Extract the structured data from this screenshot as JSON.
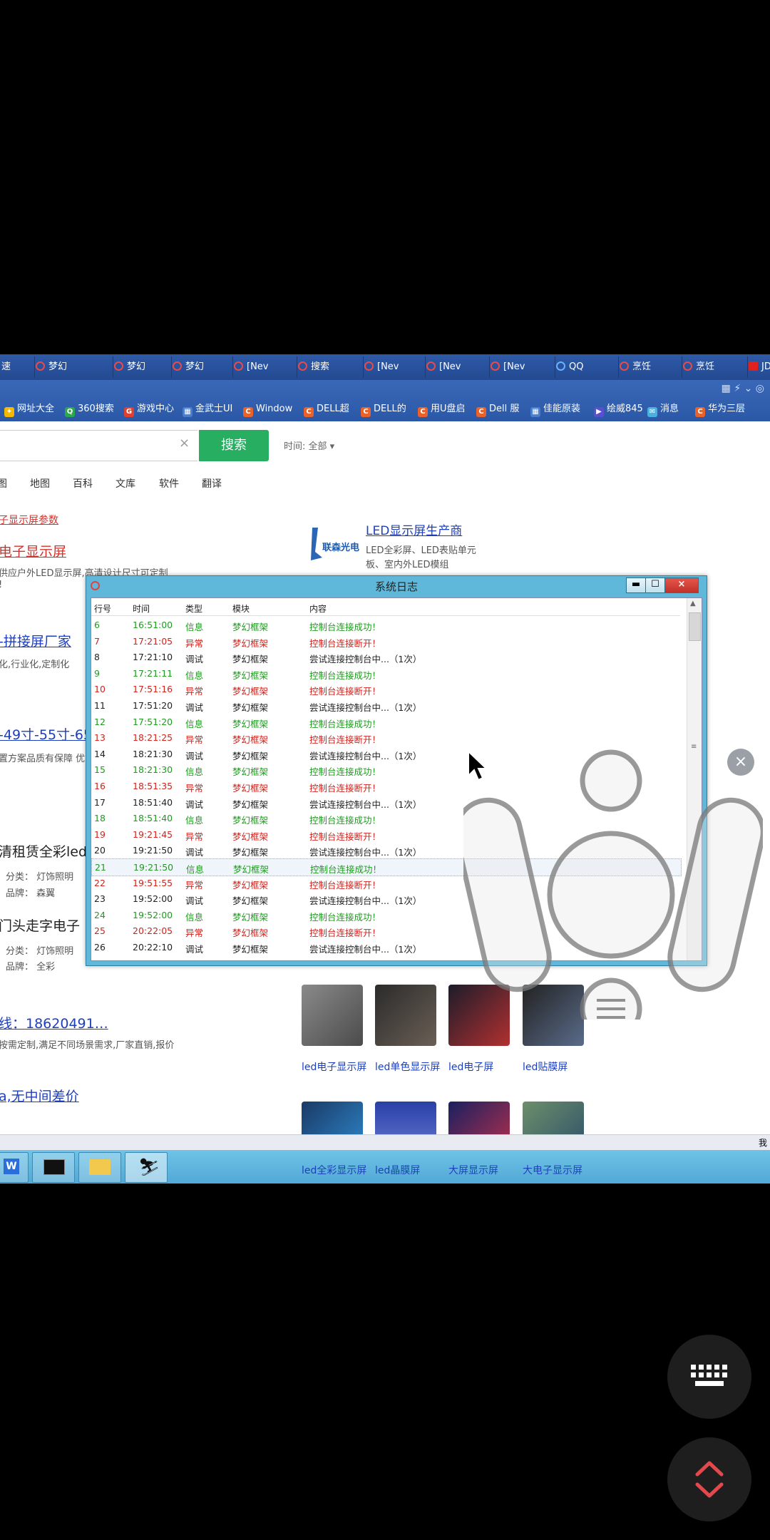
{
  "tabs": [
    {
      "label": "速",
      "type": "plain"
    },
    {
      "label": "梦幻",
      "type": "red"
    },
    {
      "label": "梦幻",
      "type": "red"
    },
    {
      "label": "梦幻",
      "type": "red"
    },
    {
      "label": "[Nev",
      "type": "red"
    },
    {
      "label": "搜索",
      "type": "red"
    },
    {
      "label": "[Nev",
      "type": "red"
    },
    {
      "label": "[Nev",
      "type": "red"
    },
    {
      "label": "[Nev",
      "type": "red"
    },
    {
      "label": "QQ",
      "type": "qq"
    },
    {
      "label": "烹饪",
      "type": "red"
    },
    {
      "label": "烹饪",
      "type": "red"
    },
    {
      "label": "JD",
      "type": "jd"
    }
  ],
  "bookmarks": [
    {
      "label": "网址大全",
      "icon": "star-icon"
    },
    {
      "label": "360搜索",
      "icon": "search-icon"
    },
    {
      "label": "游戏中心",
      "icon": "game-icon"
    },
    {
      "label": "金武士UI",
      "icon": "app-icon"
    },
    {
      "label": "Window",
      "icon": "c-icon"
    },
    {
      "label": "DELL超",
      "icon": "c-icon"
    },
    {
      "label": "DELL的",
      "icon": "c-icon"
    },
    {
      "label": "用U盘启",
      "icon": "c-icon"
    },
    {
      "label": "Dell 服",
      "icon": "c-icon"
    },
    {
      "label": "佳能原装",
      "icon": "app-icon"
    },
    {
      "label": "绘威845",
      "icon": "arrow-icon"
    },
    {
      "label": "消息",
      "icon": "msg-icon"
    },
    {
      "label": "华为三层",
      "icon": "c-icon"
    }
  ],
  "search": {
    "button": "搜索",
    "time_filter": "时间: 全部",
    "clear": "×"
  },
  "nav": [
    "图",
    "地图",
    "百科",
    "文库",
    "软件",
    "翻译"
  ],
  "results": {
    "r1_small": "子显示屏参数",
    "r1_title": "电子显示屏",
    "r1_desc": "供应户外LED显示屏,高清设计尺寸可定制",
    "r1_desc2": "!",
    "r2_title": "-拼接屏厂家",
    "r2_desc": "化,行业化,定制化",
    "r3_title": "-49寸-55寸-65",
    "r3_desc": "置方案品质有保障 优",
    "r4_title": "清租赁全彩led",
    "r4_cat": "分类：  灯饰照明",
    "r4_brand": "品牌：  森翼",
    "r5_title": "门头走字电子",
    "r5_cat": "分类：  灯饰照明",
    "r5_brand": "品牌：  全彩",
    "r6_title": "线：18620491…",
    "r6_desc": "按需定制,满足不同场景需求,厂家直销,报价",
    "r7_title": "a,无中间差价"
  },
  "ad": {
    "title": "LED显示屏生产商",
    "desc1": "LED全彩屏、LED表贴单元",
    "desc2": "板、室内外LED模组",
    "logo_text": "联森光电"
  },
  "thumbs_top": [
    "led电子显示屏",
    "led单色显示屏",
    "led电子屏",
    "led贴膜屏"
  ],
  "thumbs_bottom": [
    "led全彩显示屏",
    "led晶膜屏",
    "大屏显示屏",
    "大电子显示屏"
  ],
  "strip_right": "我",
  "log": {
    "title": "系统日志",
    "headers": [
      "行号",
      "时间",
      "类型",
      "模块",
      "内容"
    ],
    "rows": [
      {
        "n": "6",
        "t": "16:51:00",
        "type": "信息",
        "mod": "梦幻框架",
        "msg": "控制台连接成功！",
        "c": "green"
      },
      {
        "n": "7",
        "t": "17:21:05",
        "type": "异常",
        "mod": "梦幻框架",
        "msg": "控制台连接断开！",
        "c": "red"
      },
      {
        "n": "8",
        "t": "17:21:10",
        "type": "调试",
        "mod": "梦幻框架",
        "msg": "尝试连接控制台中...（1次）",
        "c": "black"
      },
      {
        "n": "9",
        "t": "17:21:11",
        "type": "信息",
        "mod": "梦幻框架",
        "msg": "控制台连接成功！",
        "c": "green"
      },
      {
        "n": "10",
        "t": "17:51:16",
        "type": "异常",
        "mod": "梦幻框架",
        "msg": "控制台连接断开！",
        "c": "red"
      },
      {
        "n": "11",
        "t": "17:51:20",
        "type": "调试",
        "mod": "梦幻框架",
        "msg": "尝试连接控制台中...（1次）",
        "c": "black"
      },
      {
        "n": "12",
        "t": "17:51:20",
        "type": "信息",
        "mod": "梦幻框架",
        "msg": "控制台连接成功！",
        "c": "green"
      },
      {
        "n": "13",
        "t": "18:21:25",
        "type": "异常",
        "mod": "梦幻框架",
        "msg": "控制台连接断开！",
        "c": "red"
      },
      {
        "n": "14",
        "t": "18:21:30",
        "type": "调试",
        "mod": "梦幻框架",
        "msg": "尝试连接控制台中...（1次）",
        "c": "black"
      },
      {
        "n": "15",
        "t": "18:21:30",
        "type": "信息",
        "mod": "梦幻框架",
        "msg": "控制台连接成功！",
        "c": "green"
      },
      {
        "n": "16",
        "t": "18:51:35",
        "type": "异常",
        "mod": "梦幻框架",
        "msg": "控制台连接断开！",
        "c": "red"
      },
      {
        "n": "17",
        "t": "18:51:40",
        "type": "调试",
        "mod": "梦幻框架",
        "msg": "尝试连接控制台中...（1次）",
        "c": "black"
      },
      {
        "n": "18",
        "t": "18:51:40",
        "type": "信息",
        "mod": "梦幻框架",
        "msg": "控制台连接成功！",
        "c": "green"
      },
      {
        "n": "19",
        "t": "19:21:45",
        "type": "异常",
        "mod": "梦幻框架",
        "msg": "控制台连接断开！",
        "c": "red"
      },
      {
        "n": "20",
        "t": "19:21:50",
        "type": "调试",
        "mod": "梦幻框架",
        "msg": "尝试连接控制台中...（1次）",
        "c": "black"
      },
      {
        "n": "21",
        "t": "19:21:50",
        "type": "信息",
        "mod": "梦幻框架",
        "msg": "控制台连接成功！",
        "c": "green",
        "selected": true
      },
      {
        "n": "22",
        "t": "19:51:55",
        "type": "异常",
        "mod": "梦幻框架",
        "msg": "控制台连接断开！",
        "c": "red"
      },
      {
        "n": "23",
        "t": "19:52:00",
        "type": "调试",
        "mod": "梦幻框架",
        "msg": "尝试连接控制台中...（1次）",
        "c": "black"
      },
      {
        "n": "24",
        "t": "19:52:00",
        "type": "信息",
        "mod": "梦幻框架",
        "msg": "控制台连接成功！",
        "c": "green"
      },
      {
        "n": "25",
        "t": "20:22:05",
        "type": "异常",
        "mod": "梦幻框架",
        "msg": "控制台连接断开！",
        "c": "red"
      },
      {
        "n": "26",
        "t": "20:22:10",
        "type": "调试",
        "mod": "梦幻框架",
        "msg": "尝试连接控制台中...（1次）",
        "c": "black"
      }
    ]
  },
  "colors": {
    "green": "#1f9b1f",
    "red": "#d2231d",
    "black": "#222222"
  }
}
